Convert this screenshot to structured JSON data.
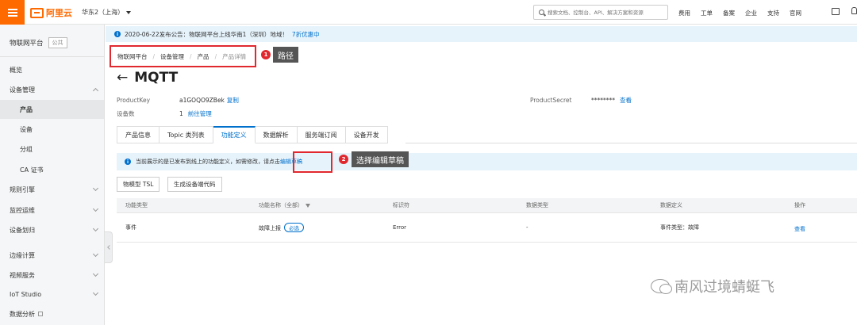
{
  "topbar": {
    "brand": "阿里云",
    "region": "华东2（上海）",
    "search_placeholder": "搜索文档、控制台、API、解决方案和资源",
    "links": [
      "费用",
      "工单",
      "备案",
      "企业",
      "支持",
      "官网"
    ]
  },
  "sidebar": {
    "title": "物联网平台",
    "badge": "公共",
    "items": [
      {
        "label": "概览"
      },
      {
        "label": "设备管理"
      },
      {
        "label": "产品"
      },
      {
        "label": "设备"
      },
      {
        "label": "分组"
      },
      {
        "label": "CA 证书"
      },
      {
        "label": "规则引擎"
      },
      {
        "label": "监控运维"
      },
      {
        "label": "设备划归"
      },
      {
        "label": "边缘计算"
      },
      {
        "label": "视频服务"
      },
      {
        "label": "IoT Studio"
      },
      {
        "label": "数据分析"
      }
    ]
  },
  "notice": {
    "text": "2020-06-22发布公告：物联网平台上线华南1（深圳）地域！",
    "link": "7折优惠中"
  },
  "breadcrumb": [
    "物联网平台",
    "设备管理",
    "产品",
    "产品详情"
  ],
  "callouts": [
    {
      "num": "1",
      "label": "路径"
    },
    {
      "num": "2",
      "label": "选择编辑草稿"
    }
  ],
  "page": {
    "title": "MQTT",
    "product_key_label": "ProductKey",
    "product_key": "a1GOQO9ZBek",
    "copy_link": "复制",
    "device_count_label": "设备数",
    "device_count": "1",
    "manage_link": "前往管理",
    "product_secret_label": "ProductSecret",
    "product_secret": "********",
    "view_link": "查看"
  },
  "tabs": [
    "产品信息",
    "Topic 类列表",
    "功能定义",
    "数据解析",
    "服务端订阅",
    "设备开发"
  ],
  "info_bar": {
    "text": "当前展示的是已发布到线上的功能定义，如需修改，请点击",
    "link": "编辑草稿"
  },
  "buttons": {
    "tsl": "物模型 TSL",
    "gen_code": "生成设备端代码"
  },
  "table": {
    "headers": [
      "功能类型",
      "功能名称（全部）",
      "标识符",
      "数据类型",
      "数据定义",
      "操作"
    ],
    "rows": [
      {
        "type": "事件",
        "name": "故障上报",
        "tag": "必选",
        "identifier": "Error",
        "data_type": "-",
        "definition": "事件类型：故障",
        "action": "查看"
      }
    ]
  },
  "watermark": "南风过境蜻蜓飞"
}
